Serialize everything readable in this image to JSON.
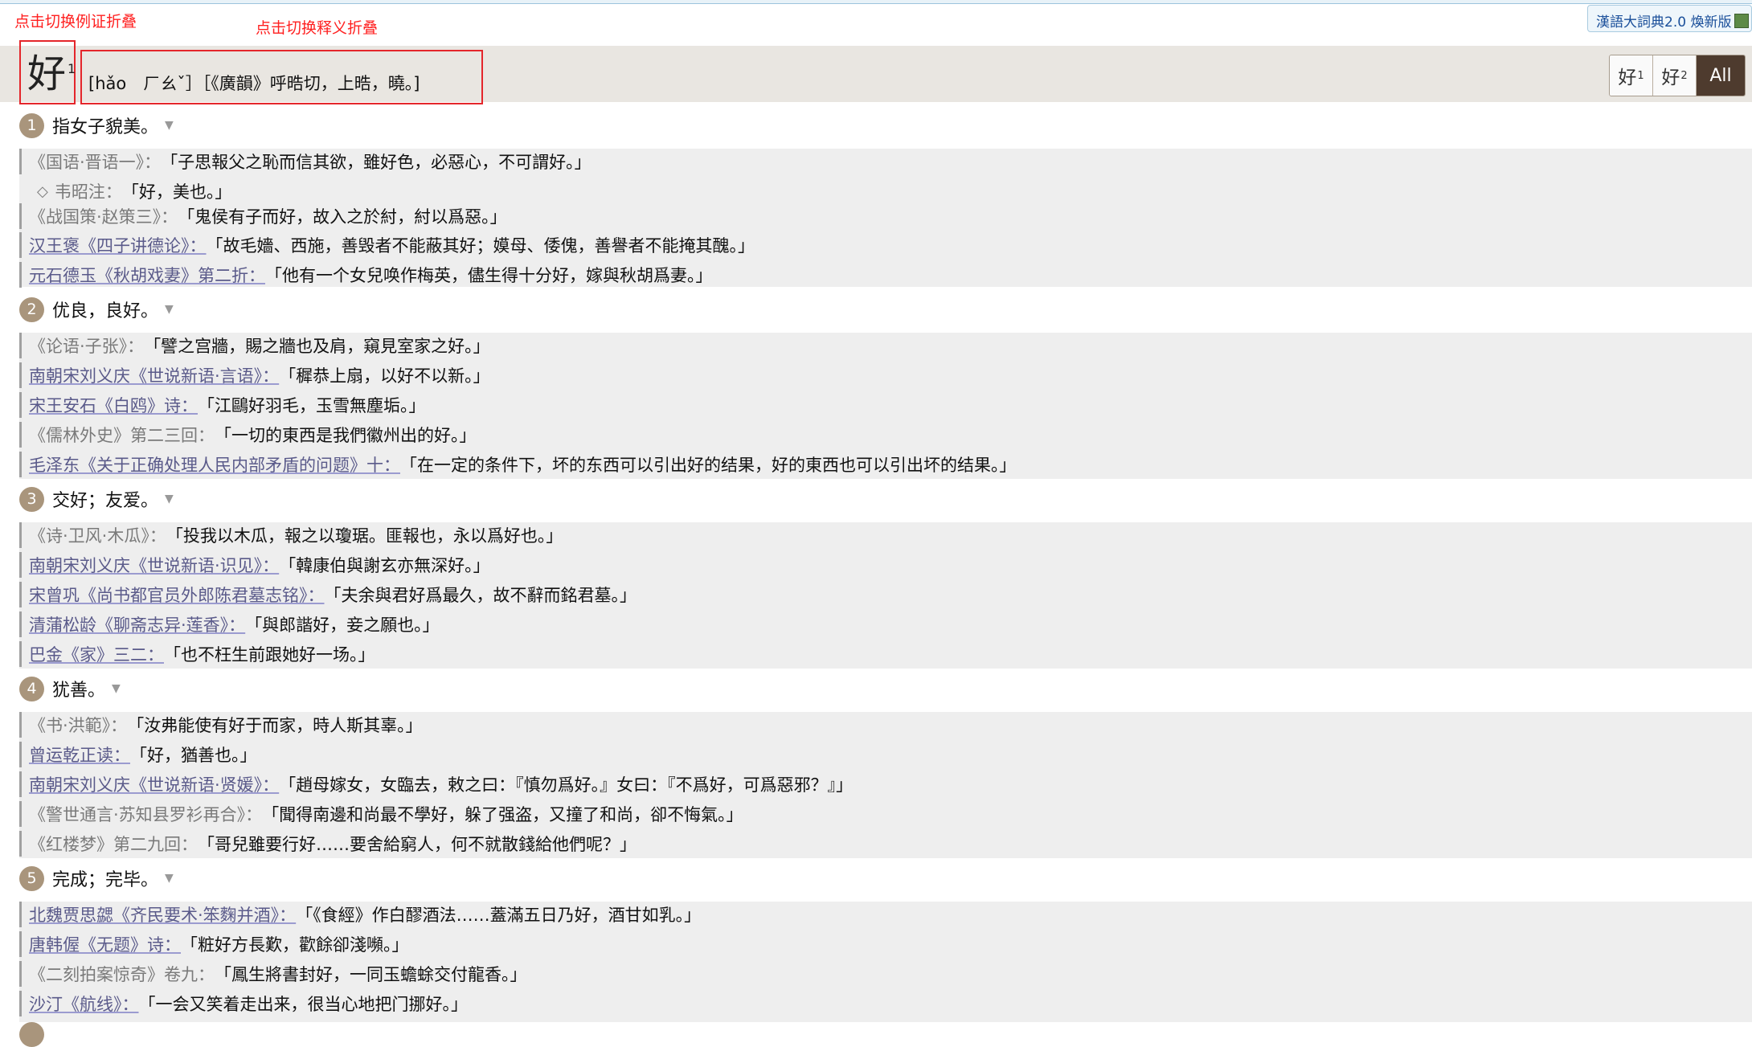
{
  "annotations": {
    "example_toggle": "点击切换例证折叠",
    "sense_toggle": "点击切换释义折叠"
  },
  "brand": {
    "label": "漢語大詞典2.0 煥新版"
  },
  "headword": {
    "char": "好",
    "sup": "1",
    "pronunciation": "[hǎo　ㄏㄠˇ］［《廣韻》呼晧切，上晧，曉。]"
  },
  "switcher": {
    "b1": "好",
    "b1_sup": "1",
    "b2": "好",
    "b2_sup": "2",
    "all": "All"
  },
  "senses": [
    {
      "num": "1",
      "def": "指女子貌美。",
      "quotes": [
        {
          "src": "《国语·晋语一》：",
          "text": "「子思報父之恥而信其欲，雖好色，必惡心，不可謂好。」"
        },
        {
          "note": true,
          "src": "韦昭注：",
          "text": "「好，美也。」"
        },
        {
          "src": "《战国策·赵策三》：",
          "text": "「鬼侯有子而好，故入之於紂，紂以爲惡。」"
        },
        {
          "src": "汉王褒《四子讲德论》：",
          "text": "「故毛嬙、西施，善毁者不能蔽其好；嫫母、倭傀，善譽者不能掩其醜。」"
        },
        {
          "src": "元石德玉《秋胡戏妻》第二折：",
          "text": "「他有一个女兒唤作梅英，儘生得十分好，嫁與秋胡爲妻。」"
        }
      ]
    },
    {
      "num": "2",
      "def": "优良，良好。",
      "quotes": [
        {
          "src": "《论语·子张》：",
          "text": "「譬之宫牆，賜之牆也及肩，窺見室家之好。」"
        },
        {
          "src": "南朝宋刘义庆《世说新语·言语》：",
          "text": "「穉恭上扇，以好不以新。」"
        },
        {
          "src": "宋王安石《白鸥》诗：",
          "text": "「江鷗好羽毛，玉雪無塵垢。」"
        },
        {
          "src": "《儒林外史》第二三回：",
          "text": "「一切的東西是我們徽州出的好。」"
        },
        {
          "src": "毛泽东《关于正确处理人民内部矛盾的问题》十：",
          "text": "「在一定的条件下，坏的东西可以引出好的结果，好的東西也可以引出坏的结果。」"
        }
      ]
    },
    {
      "num": "3",
      "def": "交好；友爱。",
      "quotes": [
        {
          "src": "《诗·卫风·木瓜》：",
          "text": "「投我以木瓜，報之以瓊琚。匪報也，永以爲好也。」"
        },
        {
          "src": "南朝宋刘义庆《世说新语·识见》：",
          "text": "「韓康伯與謝玄亦無深好。」"
        },
        {
          "src": "宋曾巩《尚书都官员外郎陈君墓志铭》：",
          "text": "「夫余與君好爲最久，故不辭而銘君墓。」"
        },
        {
          "src": "清蒲松龄《聊斋志异·莲香》：",
          "text": "「與郎諧好，妾之願也。」"
        },
        {
          "src": "巴金《家》三二：",
          "text": "「也不枉生前跟她好一场。」"
        }
      ]
    },
    {
      "num": "4",
      "def": "犹善。",
      "quotes": [
        {
          "src": "《书·洪範》：",
          "text": "「汝弗能使有好于而家，時人斯其辜。」"
        },
        {
          "src": "曾运乾正读：",
          "text": "「好，猶善也。」"
        },
        {
          "src": "南朝宋刘义庆《世说新语·贤媛》：",
          "text": "「趙母嫁女，女臨去，敕之曰：『慎勿爲好。』女曰：『不爲好，可爲惡邪？』」"
        },
        {
          "src": "《警世通言·苏知县罗衫再合》：",
          "text": "「聞得南邊和尚最不學好，躲了强盗，又撞了和尚，卻不悔氣。」"
        },
        {
          "src": "《红楼梦》第二九回：",
          "text": "「哥兒雖要行好……要舍給窮人，何不就散錢給他們呢？」"
        }
      ]
    },
    {
      "num": "5",
      "def": "完成；完毕。",
      "quotes": [
        {
          "src": "北魏贾思勰《齐民要术·笨麴并酒》：",
          "text": "「《食經》作白醪酒法……蓋滿五日乃好，酒甘如乳。」"
        },
        {
          "src": "唐韩偓《无题》诗：",
          "text": "「粧好方長歎，歡餘卻淺嚬。」"
        },
        {
          "src": "《二刻拍案惊奇》卷九：",
          "text": "「鳳生將書封好，一同玉蟾蜍交付龍香。」"
        },
        {
          "src": "沙汀《航线》：",
          "text": "「一会又笑着走出来，很当心地把门挪好。」"
        }
      ]
    }
  ]
}
